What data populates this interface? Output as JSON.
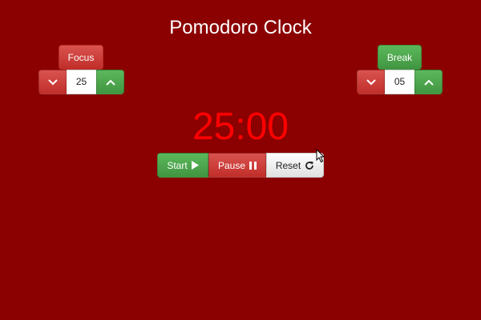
{
  "app": {
    "title": "Pomodoro Clock"
  },
  "focus": {
    "label": "Focus",
    "value": "25",
    "decrement_icon": "chevron-down-icon",
    "increment_icon": "chevron-up-icon"
  },
  "break": {
    "label": "Break",
    "value": "05",
    "decrement_icon": "chevron-down-icon",
    "increment_icon": "chevron-up-icon"
  },
  "timer": {
    "display": "25:00"
  },
  "controls": {
    "start_label": "Start",
    "start_icon": "play-icon",
    "pause_label": "Pause",
    "pause_icon": "pause-icon",
    "reset_label": "Reset",
    "reset_icon": "refresh-icon"
  },
  "colors": {
    "background": "#8b0000",
    "timer_text": "#ff0000",
    "red_button": "#d9534f",
    "green_button": "#5cb85c"
  }
}
